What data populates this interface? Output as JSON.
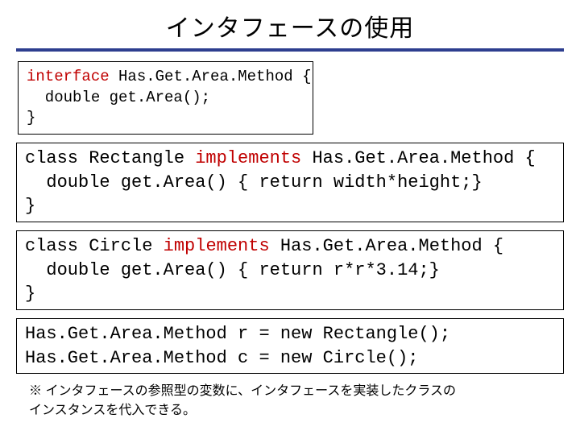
{
  "title": "インタフェースの使用",
  "box1": {
    "l1a": "interface",
    "l1b": " Has.Get.Area.Method {",
    "l2": "  double get.Area();",
    "l3": "}"
  },
  "box2": {
    "l1a": "class Rectangle ",
    "l1b": "implements",
    "l1c": " Has.Get.Area.Method {",
    "l2": "  double get.Area() { return width*height;}",
    "l3": "}"
  },
  "box3": {
    "l1a": "class Circle ",
    "l1b": "implements",
    "l1c": " Has.Get.Area.Method {",
    "l2": "  double get.Area() { return r*r*3.14;}",
    "l3": "}"
  },
  "box4": {
    "l1": "Has.Get.Area.Method r = new Rectangle();",
    "l2": "Has.Get.Area.Method c = new Circle();"
  },
  "footnote": {
    "l1": "※ インタフェースの参照型の変数に、インタフェースを実装したクラスの",
    "l2": "インスタンスを代入できる。"
  }
}
